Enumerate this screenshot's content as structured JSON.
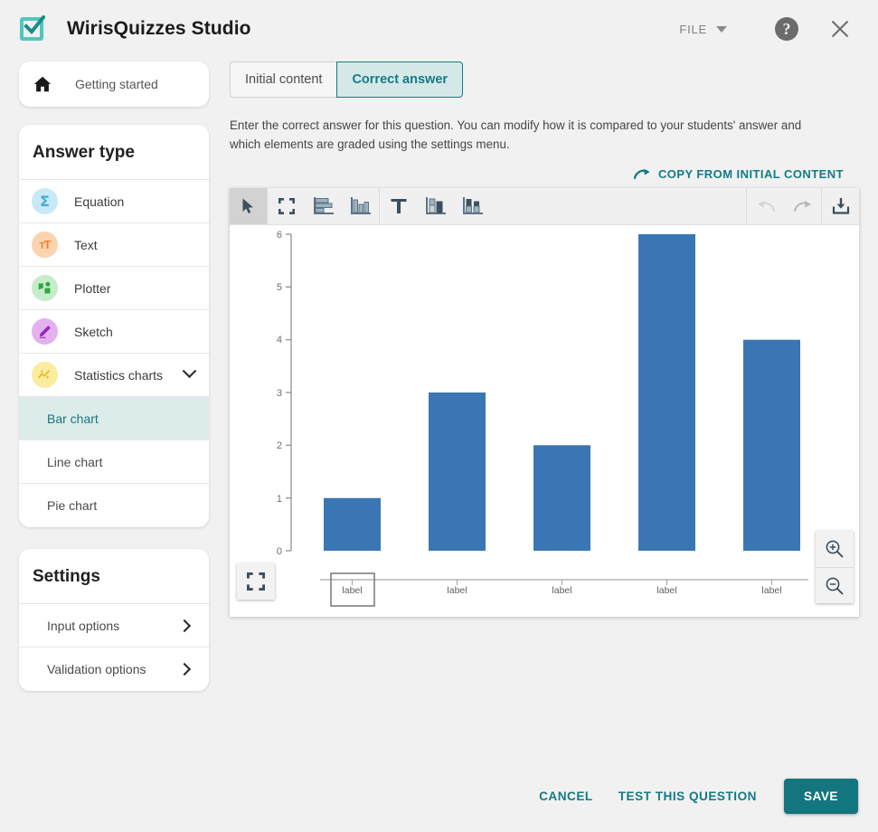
{
  "header": {
    "title": "WirisQuizzes Studio",
    "file_menu": "FILE",
    "help_icon": "help-circle-icon",
    "close_icon": "close-icon",
    "logo_icon": "checkbox-check-logo"
  },
  "sidebar": {
    "getting_started": {
      "label": "Getting started",
      "icon": "home-icon"
    },
    "answer_type": {
      "title": "Answer type",
      "items": [
        {
          "label": "Equation",
          "icon": "sigma-icon",
          "bubble": "#c8e9f5",
          "glyph": "#45a9cd"
        },
        {
          "label": "Text",
          "icon": "text-format-icon",
          "bubble": "#fbd3ae",
          "glyph": "#e8812c"
        },
        {
          "label": "Plotter",
          "icon": "plotter-icon",
          "bubble": "#c6ecc9",
          "glyph": "#2fa83f"
        },
        {
          "label": "Sketch",
          "icon": "pencil-icon",
          "bubble": "#e3b0f0",
          "glyph": "#9327b7"
        },
        {
          "label": "Statistics charts",
          "icon": "statistics-sparkle-icon",
          "bubble": "#fbeca0",
          "glyph": "#e2b71b"
        }
      ],
      "expand_icon": "chevron-down-icon"
    },
    "chart_types": [
      {
        "label": "Bar chart",
        "active": true
      },
      {
        "label": "Line chart",
        "active": false
      },
      {
        "label": "Pie chart",
        "active": false
      }
    ],
    "settings": {
      "title": "Settings",
      "items": [
        {
          "label": "Input options",
          "icon": "chevron-right-icon"
        },
        {
          "label": "Validation options",
          "icon": "chevron-right-icon"
        }
      ]
    }
  },
  "main": {
    "tabs": [
      {
        "label": "Initial content",
        "active": false
      },
      {
        "label": "Correct answer",
        "active": true
      }
    ],
    "description": "Enter the correct answer for this question. You can modify how it is compared to your students' answer and which elements are graded using the settings menu.",
    "copy_from_initial": {
      "label": "COPY FROM INITIAL CONTENT",
      "icon": "redo-arrow-icon"
    },
    "toolbar": [
      {
        "name": "select-tool",
        "icon": "cursor-arrow-icon",
        "active": true
      },
      {
        "name": "fit-screen-tool",
        "icon": "fit-screen-icon",
        "active": false
      },
      {
        "name": "horizontal-bar-tool",
        "icon": "horizontal-bar-chart-icon",
        "active": false
      },
      {
        "name": "vertical-bar-tool",
        "icon": "vertical-bar-chart-icon",
        "active": false
      },
      {
        "name": "text-tool",
        "icon": "text-T-icon",
        "active": false
      },
      {
        "name": "stacked-bar-tool",
        "icon": "stacked-bar-chart-icon",
        "active": false
      },
      {
        "name": "grouped-bar-tool",
        "icon": "grouped-bar-chart-icon",
        "active": false
      }
    ],
    "toolbar_right": [
      {
        "name": "undo-button",
        "icon": "undo-icon",
        "disabled": true
      },
      {
        "name": "redo-button",
        "icon": "redo-icon",
        "disabled": false
      },
      {
        "name": "download-button",
        "icon": "download-icon",
        "disabled": false
      }
    ],
    "canvas_controls": {
      "fullscreen": "fit-screen-icon",
      "zoom_in": "zoom-in-icon",
      "zoom_out": "zoom-out-icon"
    }
  },
  "footer": {
    "cancel": "CANCEL",
    "test": "TEST THIS QUESTION",
    "save": "SAVE"
  },
  "colors": {
    "accent": "#137b84",
    "bar": "#3b76b4",
    "active_row": "#dceceb"
  },
  "chart_data": {
    "type": "bar",
    "title": "",
    "xlabel": "",
    "ylabel": "",
    "categories": [
      "label",
      "label",
      "label",
      "label",
      "label"
    ],
    "values": [
      1,
      3,
      2,
      6,
      4
    ],
    "ylim": [
      0,
      6
    ],
    "yticks": [
      0,
      1,
      2,
      3,
      4,
      5,
      6
    ],
    "grid": false,
    "legend": false,
    "bar_color": "#3b76b4",
    "selected_category_index": 0
  }
}
